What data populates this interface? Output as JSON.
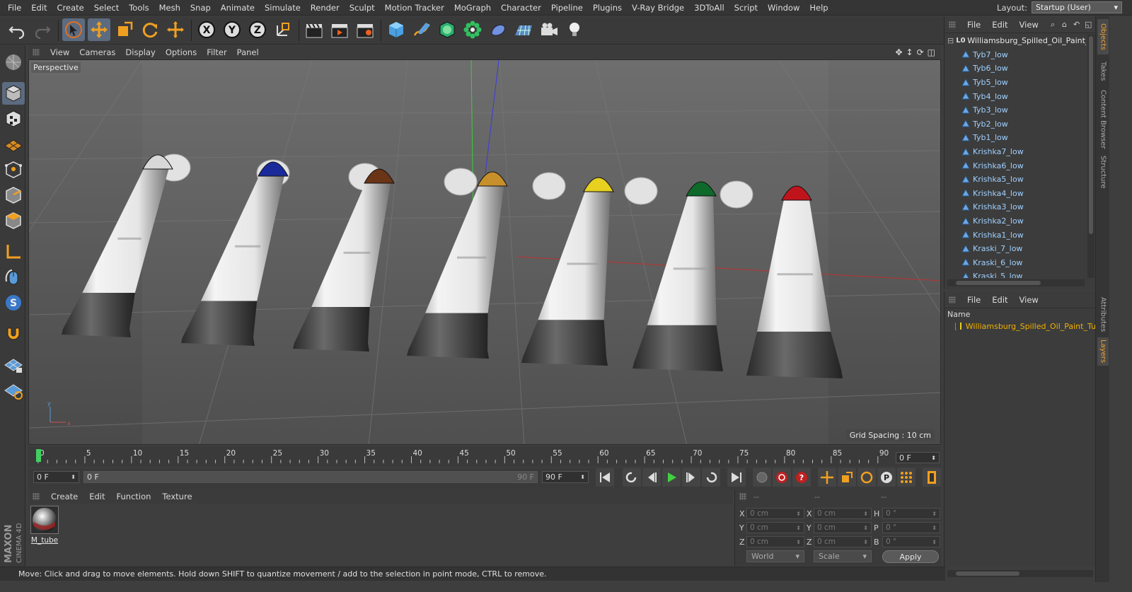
{
  "menu": [
    "File",
    "Edit",
    "Create",
    "Select",
    "Tools",
    "Mesh",
    "Snap",
    "Animate",
    "Simulate",
    "Render",
    "Sculpt",
    "Motion Tracker",
    "MoGraph",
    "Character",
    "Pipeline",
    "Plugins",
    "V-Ray Bridge",
    "3DToAll",
    "Script",
    "Window",
    "Help"
  ],
  "layout": {
    "label": "Layout:",
    "value": "Startup (User)"
  },
  "viewport": {
    "menu": [
      "View",
      "Cameras",
      "Display",
      "Options",
      "Filter",
      "Panel"
    ],
    "camera_label": "Perspective",
    "grid_spacing": "Grid Spacing : 10 cm"
  },
  "timeline": {
    "ticks": [
      "0",
      "5",
      "10",
      "15",
      "20",
      "25",
      "30",
      "35",
      "40",
      "45",
      "50",
      "55",
      "60",
      "65",
      "70",
      "75",
      "80",
      "85",
      "90"
    ],
    "current_frame": "0 F"
  },
  "transport": {
    "start": "0 F",
    "slider_left": "0 F",
    "slider_right": "90 F",
    "end": "90 F"
  },
  "material": {
    "menu": [
      "Create",
      "Edit",
      "Function",
      "Texture"
    ],
    "name": "M_tube"
  },
  "coords": {
    "headers": [
      "--",
      "--",
      "--"
    ],
    "rows": [
      {
        "a": "X",
        "av": "0 cm",
        "b": "X",
        "bv": "0 cm",
        "c": "H",
        "cv": "0 °"
      },
      {
        "a": "Y",
        "av": "0 cm",
        "b": "Y",
        "bv": "0 cm",
        "c": "P",
        "cv": "0 °"
      },
      {
        "a": "Z",
        "av": "0 cm",
        "b": "Z",
        "bv": "0 cm",
        "c": "B",
        "cv": "0 °"
      }
    ],
    "space": "World",
    "mode": "Scale",
    "apply": "Apply"
  },
  "status": "Move: Click and drag to move elements. Hold down SHIFT to quantize movement / add to the selection in point mode, CTRL to remove.",
  "objects": {
    "menu": [
      "File",
      "Edit",
      "View"
    ],
    "root": "Williamsburg_Spilled_Oil_Paint_",
    "items": [
      "Tyb7_low",
      "Tyb6_low",
      "Tyb5_low",
      "Tyb4_low",
      "Tyb3_low",
      "Tyb2_low",
      "Tyb1_low",
      "Krishka7_low",
      "Krishka6_low",
      "Krishka5_low",
      "Krishka4_low",
      "Krishka3_low",
      "Krishka2_low",
      "Krishka1_low",
      "Kraski_7_low",
      "Kraski_6_low",
      "Kraski_5_low"
    ]
  },
  "layers": {
    "menu": [
      "File",
      "Edit",
      "View"
    ],
    "header": "Name",
    "row": "Williamsburg_Spilled_Oil_Paint_Tu"
  },
  "side_tabs": [
    "Objects",
    "Takes",
    "Content Browser",
    "Structure",
    "Attributes",
    "Layers"
  ],
  "tubes": [
    {
      "cap": "#d8d8d8"
    },
    {
      "cap": "#1a2a9a"
    },
    {
      "cap": "#6a3416"
    },
    {
      "cap": "#c8902a"
    },
    {
      "cap": "#e8d020"
    },
    {
      "cap": "#0e6a2a"
    },
    {
      "cap": "#c0141c"
    }
  ],
  "colors": {
    "accent": "#5c6b80",
    "object_text": "#9fd0ff",
    "layer_text": "#f0b000",
    "side_active": "#f0a030"
  }
}
